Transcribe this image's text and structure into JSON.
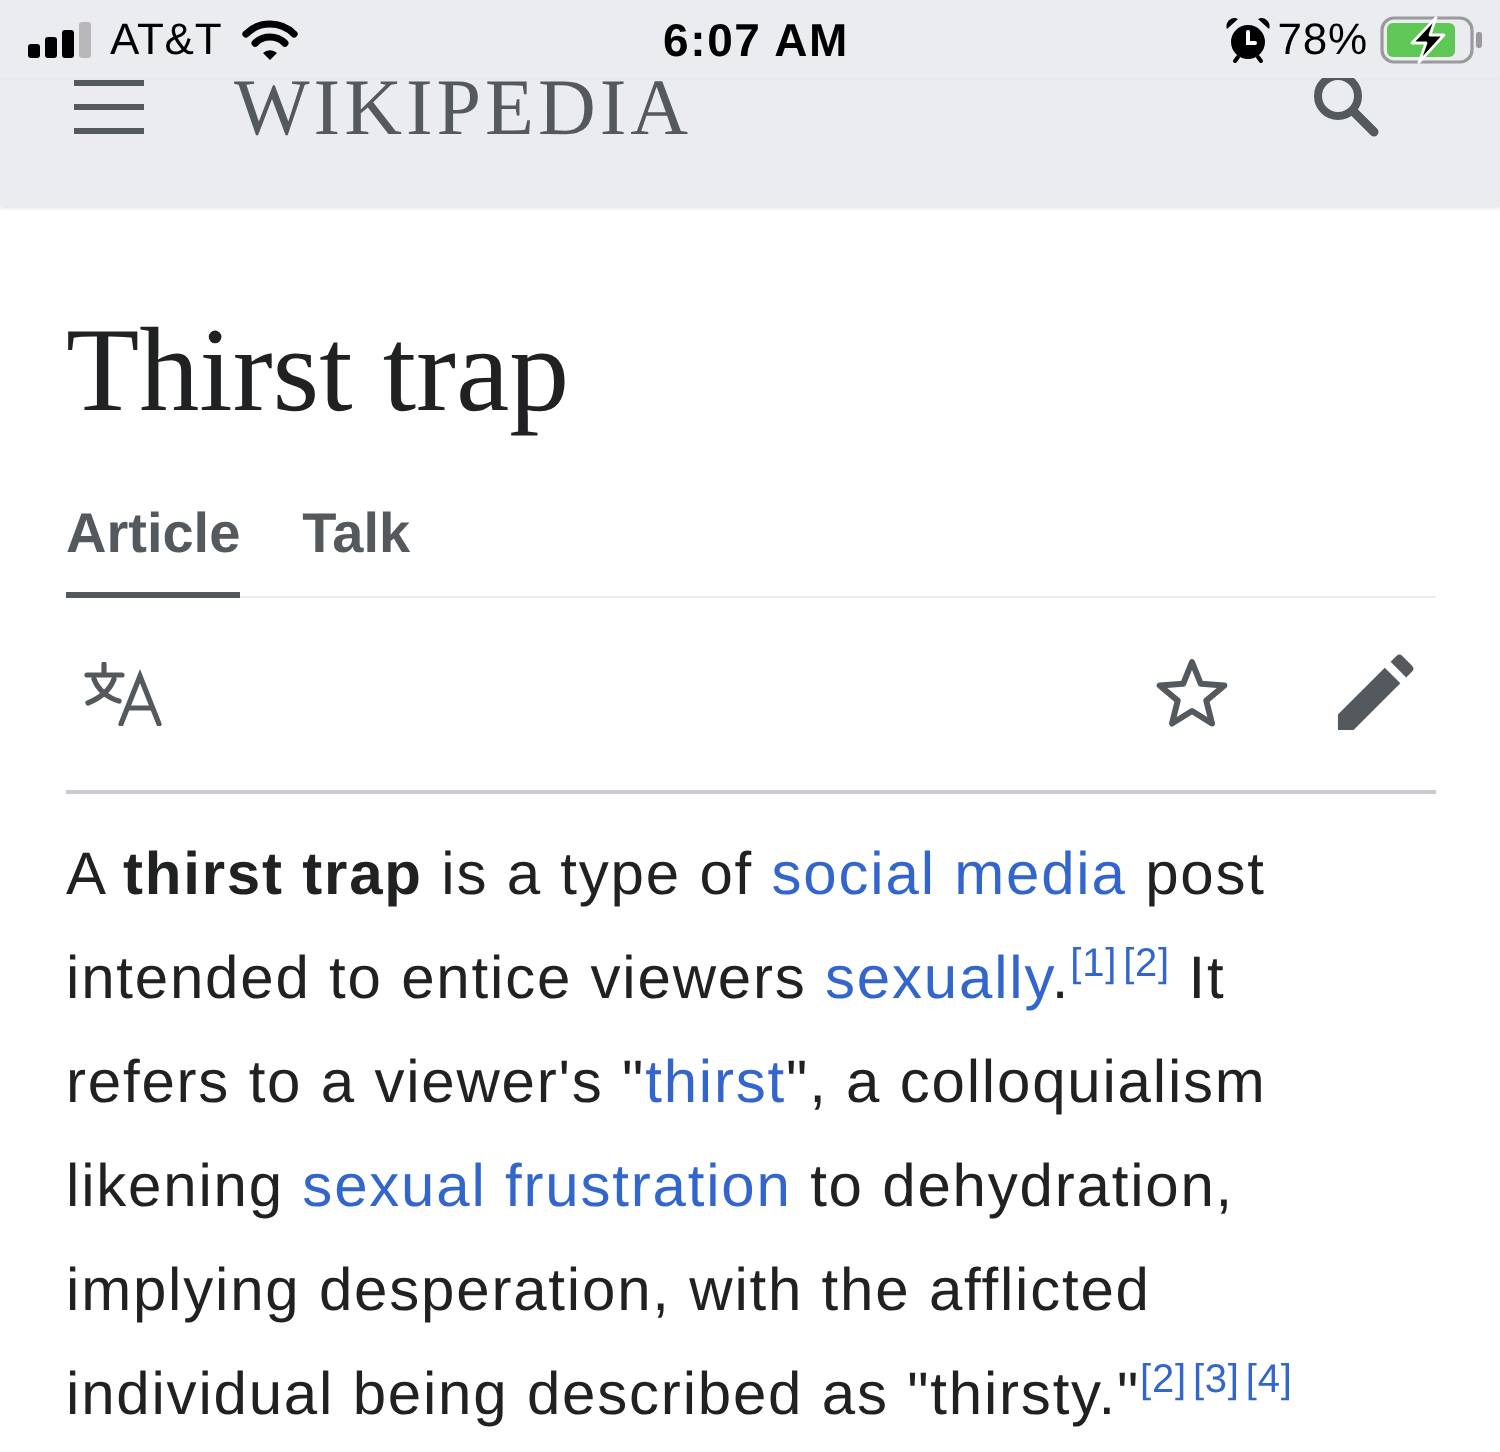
{
  "status_bar": {
    "carrier": "AT&T",
    "time": "6:07 AM",
    "battery": "78%",
    "charging": true
  },
  "header": {
    "logo": "WIKIPEDIA"
  },
  "page": {
    "title": "Thirst trap",
    "tabs": [
      {
        "label": "Article",
        "selected": true
      },
      {
        "label": "Talk",
        "selected": false
      }
    ]
  },
  "paragraph": [
    {
      "kind": "text",
      "text": "A **thirst trap** is a type of "
    },
    {
      "kind": "link",
      "text": "social media"
    },
    {
      "kind": "text",
      "text": " post intended to entice viewers "
    },
    {
      "kind": "link",
      "text": "sexually"
    },
    {
      "kind": "text",
      "text": "."
    },
    {
      "kind": "ref",
      "text": "[1]"
    },
    {
      "kind": "ref",
      "text": "[2]"
    },
    {
      "kind": "text",
      "text": " It refers to a viewer's \""
    },
    {
      "kind": "link",
      "text": "thirst"
    },
    {
      "kind": "text",
      "text": "\", a colloquialism likening "
    },
    {
      "kind": "link",
      "text": "sexual frustration"
    },
    {
      "kind": "text",
      "text": " to dehydration, implying desperation, with the afflicted individual being described as \"thirsty.\""
    },
    {
      "kind": "ref",
      "text": "[2]"
    },
    {
      "kind": "ref",
      "text": "[3]"
    },
    {
      "kind": "ref",
      "text": "[4]"
    }
  ]
}
